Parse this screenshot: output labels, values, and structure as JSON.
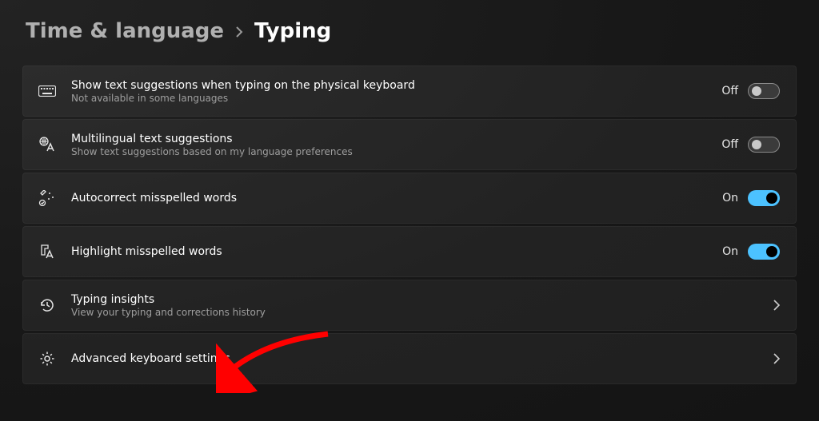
{
  "breadcrumb": {
    "parent": "Time & language",
    "current": "Typing"
  },
  "items": [
    {
      "icon": "keyboard-icon",
      "title": "Show text suggestions when typing on the physical keyboard",
      "subtitle": "Not available in some languages",
      "control": "toggle",
      "state_label": "Off",
      "state_on": false
    },
    {
      "icon": "multilingual-icon",
      "title": "Multilingual text suggestions",
      "subtitle": "Show text suggestions based on my language preferences",
      "control": "toggle",
      "state_label": "Off",
      "state_on": false
    },
    {
      "icon": "autocorrect-icon",
      "title": "Autocorrect misspelled words",
      "subtitle": "",
      "control": "toggle",
      "state_label": "On",
      "state_on": true
    },
    {
      "icon": "highlight-icon",
      "title": "Highlight misspelled words",
      "subtitle": "",
      "control": "toggle",
      "state_label": "On",
      "state_on": true
    },
    {
      "icon": "history-icon",
      "title": "Typing insights",
      "subtitle": "View your typing and corrections history",
      "control": "link",
      "state_label": "",
      "state_on": false
    },
    {
      "icon": "gear-icon",
      "title": "Advanced keyboard settings",
      "subtitle": "",
      "control": "link",
      "state_label": "",
      "state_on": false
    }
  ],
  "annotation": {
    "type": "arrow",
    "color": "#ff0000",
    "target_index": 5
  }
}
